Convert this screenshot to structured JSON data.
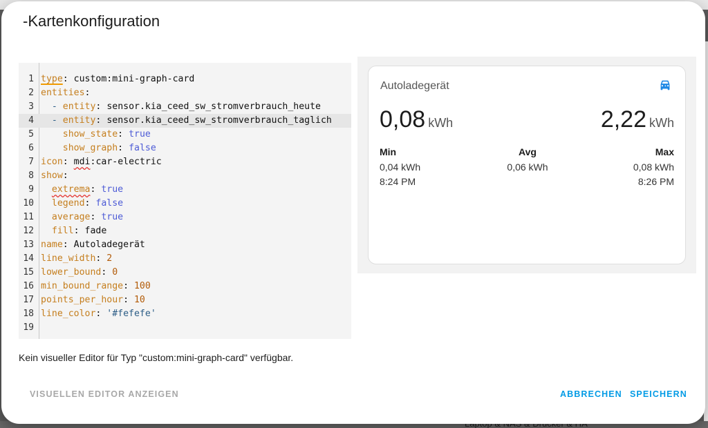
{
  "dialog": {
    "title": "-Kartenkonfiguration",
    "note": "Kein visueller Editor für Typ \"custom:mini-graph-card\" verfügbar.",
    "buttons": {
      "visual_editor": "VISUELLEN EDITOR ANZEIGEN",
      "cancel": "ABBRECHEN",
      "save": "SPEICHERN"
    }
  },
  "backdrop": {
    "item_text": "Laptop & NAS & Drucker & HA"
  },
  "editor": {
    "line_numbers": [
      "1",
      "2",
      "3",
      "4",
      "5",
      "6",
      "7",
      "8",
      "9",
      "10",
      "11",
      "12",
      "13",
      "14",
      "15",
      "16",
      "17",
      "18",
      "19"
    ],
    "lines": [
      {
        "indent": "",
        "dash": "",
        "key": "type",
        "sep": ":",
        "value": " custom:mini-graph-card"
      },
      {
        "indent": "",
        "dash": "",
        "key": "entities",
        "sep": ":",
        "value": ""
      },
      {
        "indent": "  ",
        "dash": "- ",
        "key": "entity",
        "sep": ":",
        "value": " sensor.kia_ceed_sw_stromverbrauch_heute"
      },
      {
        "indent": "  ",
        "dash": "- ",
        "key": "entity",
        "sep": ":",
        "value": " sensor.kia_ceed_sw_stromverbrauch_taglich"
      },
      {
        "indent": "    ",
        "dash": "",
        "key": "show_state",
        "sep": ":",
        "value": " true"
      },
      {
        "indent": "    ",
        "dash": "",
        "key": "show_graph",
        "sep": ":",
        "value": " false"
      },
      {
        "indent": "",
        "dash": "",
        "key": "icon",
        "sep": ":",
        "value": " mdi:car-electric"
      },
      {
        "indent": "",
        "dash": "",
        "key": "show",
        "sep": ":",
        "value": ""
      },
      {
        "indent": "  ",
        "dash": "",
        "key": "extrema",
        "sep": ":",
        "value": " true"
      },
      {
        "indent": "  ",
        "dash": "",
        "key": "legend",
        "sep": ":",
        "value": " false"
      },
      {
        "indent": "  ",
        "dash": "",
        "key": "average",
        "sep": ":",
        "value": " true"
      },
      {
        "indent": "  ",
        "dash": "",
        "key": "fill",
        "sep": ":",
        "value": " fade"
      },
      {
        "indent": "",
        "dash": "",
        "key": "name",
        "sep": ":",
        "value": " Autoladegerät"
      },
      {
        "indent": "",
        "dash": "",
        "key": "line_width",
        "sep": ":",
        "value": " 2"
      },
      {
        "indent": "",
        "dash": "",
        "key": "lower_bound",
        "sep": ":",
        "value": " 0"
      },
      {
        "indent": "",
        "dash": "",
        "key": "min_bound_range",
        "sep": ":",
        "value": " 100"
      },
      {
        "indent": "",
        "dash": "",
        "key": "points_per_hour",
        "sep": ":",
        "value": " 10"
      },
      {
        "indent": "",
        "dash": "",
        "key": "line_color",
        "sep": ":",
        "value": " '#fefefe'"
      },
      {
        "indent": "",
        "dash": "",
        "key": "",
        "sep": "",
        "value": ""
      }
    ],
    "active_line": 4
  },
  "preview": {
    "card_title": "Autoladegerät",
    "icon": "car-electric-icon",
    "state_left": {
      "value": "0,08",
      "unit": "kWh"
    },
    "state_right": {
      "value": "2,22",
      "unit": "kWh"
    },
    "extrema": {
      "min": {
        "label": "Min",
        "value": "0,04 kWh",
        "time": "8:24 PM"
      },
      "avg": {
        "label": "Avg",
        "value": "0,06 kWh"
      },
      "max": {
        "label": "Max",
        "value": "0,08 kWh",
        "time": "8:26 PM"
      }
    }
  },
  "colors": {
    "accent": "#039be5",
    "icon": "#1e88e5",
    "yaml_key": "#c57e1d",
    "yaml_bool": "#4d5bd6",
    "yaml_number": "#b25b08"
  }
}
